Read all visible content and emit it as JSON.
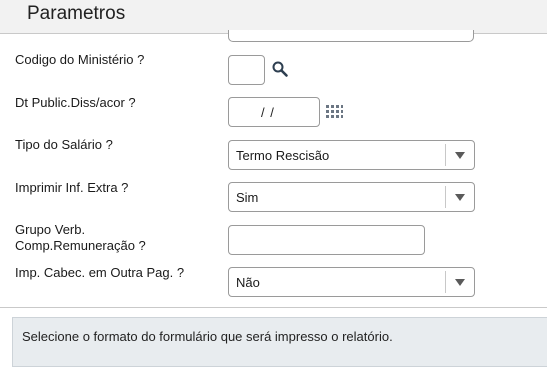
{
  "header": {
    "title": "Parametros"
  },
  "fields": {
    "codigo_ministerio": {
      "label": "Codigo do Ministério ?",
      "value": ""
    },
    "dt_public": {
      "label": "Dt Public.Diss/acor ?",
      "value": " /  /"
    },
    "tipo_salario": {
      "label": "Tipo do Salário ?",
      "value": "Termo Rescisão"
    },
    "imprimir_inf_extra": {
      "label": "Imprimir Inf. Extra ?",
      "value": "Sim"
    },
    "grupo_verb": {
      "label_line1": "Grupo Verb.",
      "label_line2": "Comp.Remuneração ?",
      "value": ""
    },
    "imp_cabec": {
      "label": "Imp. Cabec. em Outra Pag. ?",
      "value": "Não"
    }
  },
  "help": {
    "text": "Selecione o formato do formulário que será impresso o relatório."
  },
  "icons": {
    "lookup": "search-icon",
    "date": "calendar-icon",
    "dropdown": "chevron-down-icon"
  },
  "colors": {
    "header_bg": "#f2f2f2",
    "help_bg": "#e8ecef",
    "border": "#9a9a9a"
  }
}
